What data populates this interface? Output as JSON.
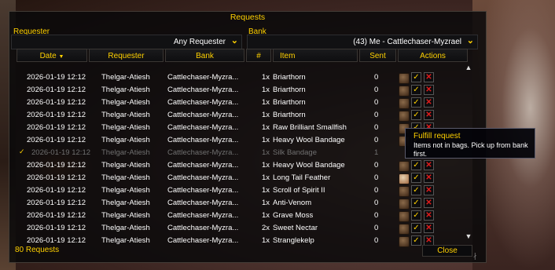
{
  "window": {
    "title": "Requests"
  },
  "filters": {
    "requester_label": "Requester",
    "requester_value": "Any Requester",
    "bank_label": "Bank",
    "bank_value": "(43) Me - Cattlechaser-Myzrael"
  },
  "columns": {
    "date": "Date",
    "sort_glyph": "▼",
    "requester": "Requester",
    "bank": "Bank",
    "qty": "#",
    "item": "Item",
    "sent": "Sent",
    "actions": "Actions"
  },
  "colors": {
    "accent": "#ffd100",
    "cancel": "#e21c1c",
    "dim_row": "#707070"
  },
  "rows": [
    {
      "date": "2026-01-19 12:12",
      "requester": "Thelgar-Atiesh",
      "bank": "Cattlechaser-Myzra...",
      "qty": "1x",
      "item": "Briarthorn",
      "sent": "0",
      "icon": "bag-icon"
    },
    {
      "date": "2026-01-19 12:12",
      "requester": "Thelgar-Atiesh",
      "bank": "Cattlechaser-Myzra...",
      "qty": "1x",
      "item": "Briarthorn",
      "sent": "0",
      "icon": "bag-icon"
    },
    {
      "date": "2026-01-19 12:12",
      "requester": "Thelgar-Atiesh",
      "bank": "Cattlechaser-Myzra...",
      "qty": "1x",
      "item": "Briarthorn",
      "sent": "0",
      "icon": "bag-icon"
    },
    {
      "date": "2026-01-19 12:12",
      "requester": "Thelgar-Atiesh",
      "bank": "Cattlechaser-Myzra...",
      "qty": "1x",
      "item": "Briarthorn",
      "sent": "0",
      "icon": "bag-icon"
    },
    {
      "date": "2026-01-19 12:12",
      "requester": "Thelgar-Atiesh",
      "bank": "Cattlechaser-Myzra...",
      "qty": "1x",
      "item": "Raw Brilliant Smallfish",
      "sent": "0",
      "icon": "bag-icon"
    },
    {
      "date": "2026-01-19 12:12",
      "requester": "Thelgar-Atiesh",
      "bank": "Cattlechaser-Myzra...",
      "qty": "1x",
      "item": "Heavy Wool Bandage",
      "sent": "0",
      "icon": "bag-icon"
    },
    {
      "date": "2026-01-19 12:12",
      "requester": "Thelgar-Atiesh",
      "bank": "Cattlechaser-Myzra...",
      "qty": "1x",
      "item": "Silk Bandage",
      "sent": "1",
      "icon": "",
      "dim": true
    },
    {
      "date": "2026-01-19 12:12",
      "requester": "Thelgar-Atiesh",
      "bank": "Cattlechaser-Myzra...",
      "qty": "1x",
      "item": "Heavy Wool Bandage",
      "sent": "0",
      "icon": "bag-icon"
    },
    {
      "date": "2026-01-19 12:12",
      "requester": "Thelgar-Atiesh",
      "bank": "Cattlechaser-Myzra...",
      "qty": "1x",
      "item": "Long Tail Feather",
      "sent": "0",
      "icon": "feather-icon"
    },
    {
      "date": "2026-01-19 12:12",
      "requester": "Thelgar-Atiesh",
      "bank": "Cattlechaser-Myzra...",
      "qty": "1x",
      "item": "Scroll of Spirit II",
      "sent": "0",
      "icon": "bag-icon"
    },
    {
      "date": "2026-01-19 12:12",
      "requester": "Thelgar-Atiesh",
      "bank": "Cattlechaser-Myzra...",
      "qty": "1x",
      "item": "Anti-Venom",
      "sent": "0",
      "icon": "bag-icon"
    },
    {
      "date": "2026-01-19 12:12",
      "requester": "Thelgar-Atiesh",
      "bank": "Cattlechaser-Myzra...",
      "qty": "1x",
      "item": "Grave Moss",
      "sent": "0",
      "icon": "bag-icon"
    },
    {
      "date": "2026-01-19 12:12",
      "requester": "Thelgar-Atiesh",
      "bank": "Cattlechaser-Myzra...",
      "qty": "2x",
      "item": "Sweet Nectar",
      "sent": "0",
      "icon": "bag-icon"
    },
    {
      "date": "2026-01-19 12:12",
      "requester": "Thelgar-Atiesh",
      "bank": "Cattlechaser-Myzra...",
      "qty": "1x",
      "item": "Stranglekelp",
      "sent": "0",
      "icon": "bag-icon"
    }
  ],
  "actions": {
    "fulfill_glyph": "✓",
    "cancel_glyph": "✕"
  },
  "tooltip": {
    "title": "Fulfill request",
    "body": "Items not in bags. Pick up from bank first."
  },
  "footer": {
    "count": "80 Requests",
    "close_label": "Close"
  },
  "scroll": {
    "up_glyph": "▲",
    "down_glyph": "▼"
  }
}
